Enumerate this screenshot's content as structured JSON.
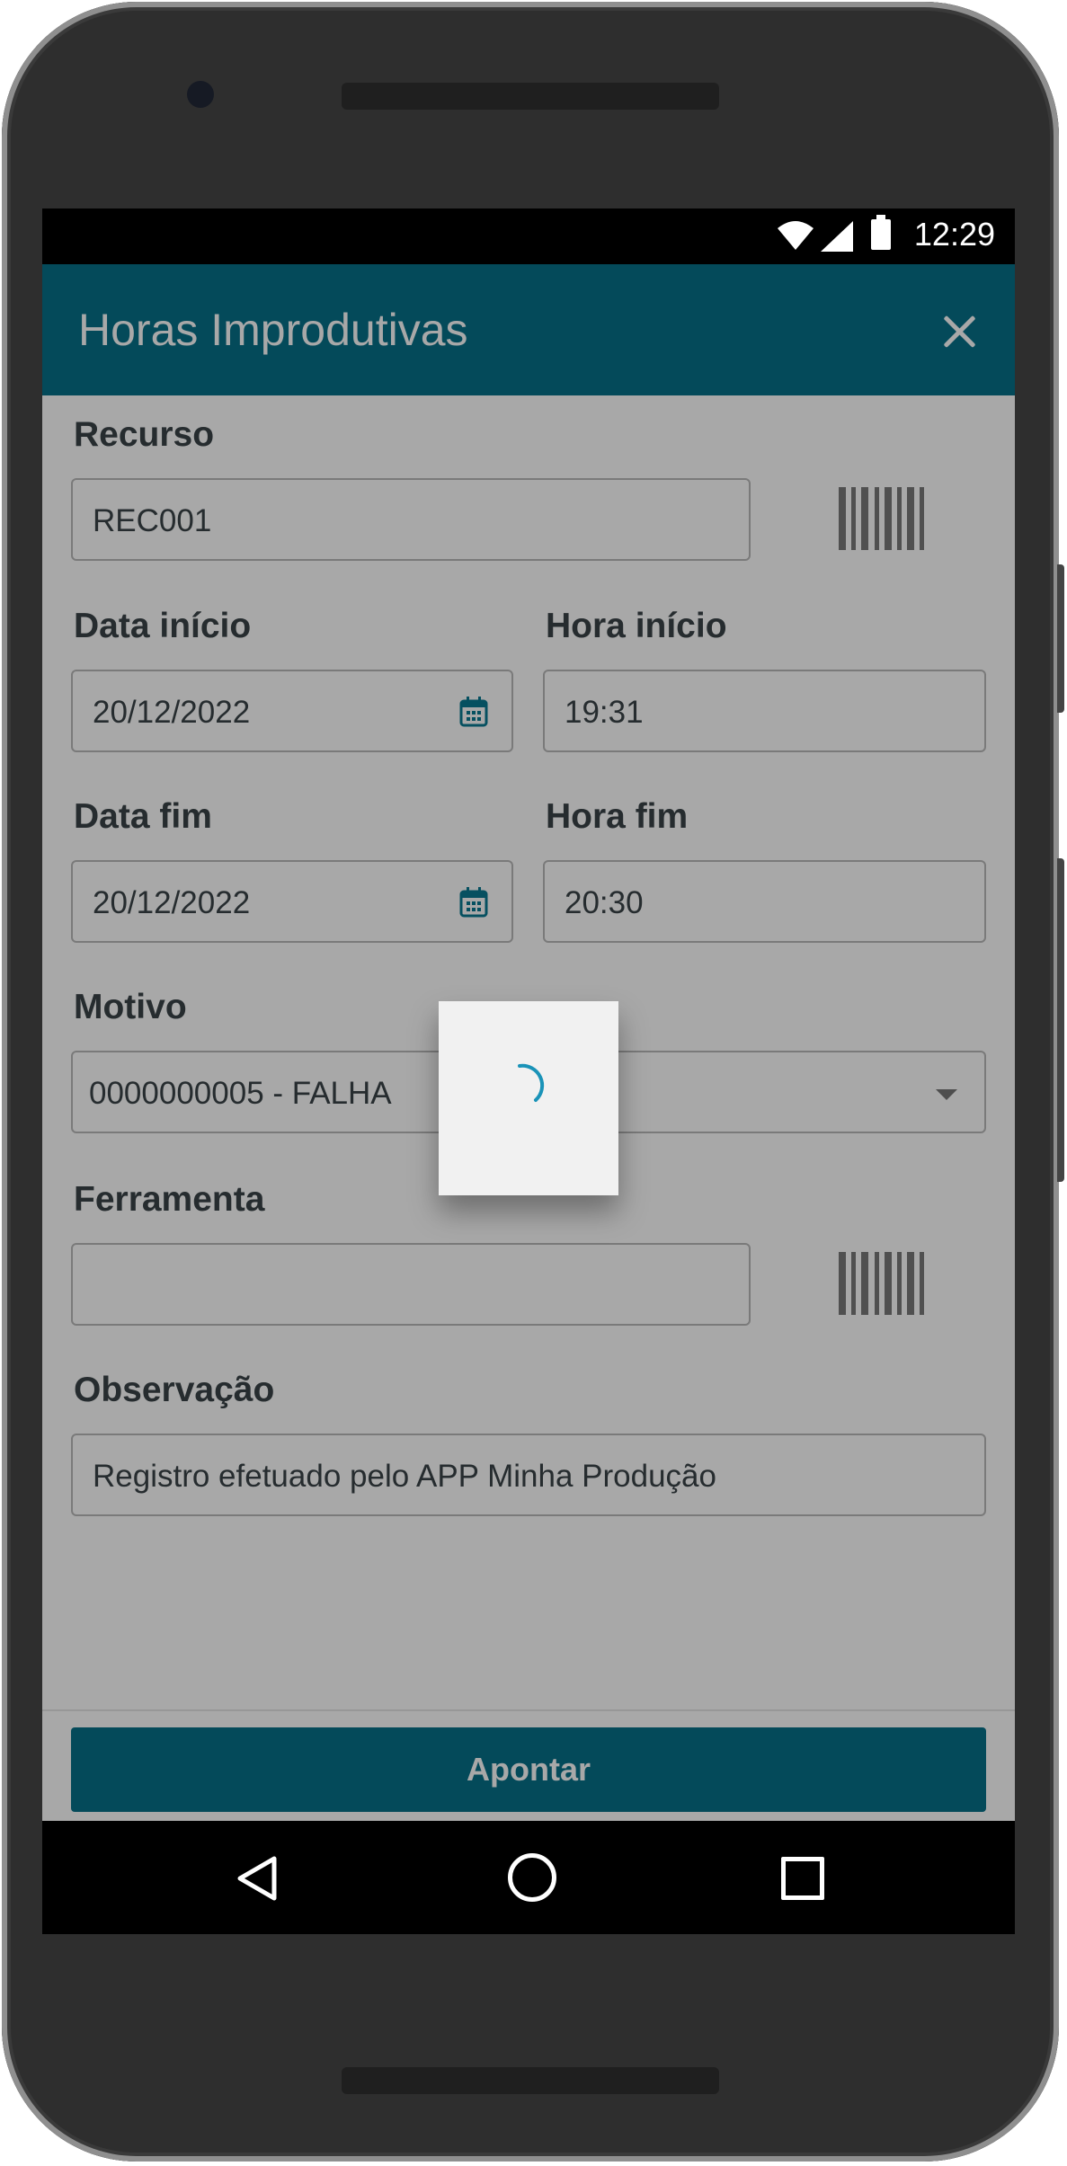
{
  "status_bar": {
    "time": "12:29"
  },
  "header": {
    "title": "Horas Improdutivas"
  },
  "form": {
    "recurso": {
      "label": "Recurso",
      "value": "REC001"
    },
    "data_inicio": {
      "label": "Data início",
      "value": "20/12/2022"
    },
    "hora_inicio": {
      "label": "Hora início",
      "value": "19:31"
    },
    "data_fim": {
      "label": "Data fim",
      "value": "20/12/2022"
    },
    "hora_fim": {
      "label": "Hora fim",
      "value": "20:30"
    },
    "motivo": {
      "label": "Motivo",
      "value": "0000000005 - FALHA "
    },
    "ferramenta": {
      "label": "Ferramenta",
      "value": ""
    },
    "observacao": {
      "label": "Observação",
      "value": "Registro efetuado pelo APP Minha Produção"
    }
  },
  "footer": {
    "submit_label": "Apontar"
  },
  "icons": {
    "close": "close-icon",
    "calendar": "calendar-icon",
    "barcode": "barcode-icon",
    "dropdown": "chevron-down-icon",
    "spinner": "loading-spinner-icon"
  },
  "colors": {
    "primary": "#077189",
    "overlay": "rgba(0,0,0,0.34)"
  }
}
